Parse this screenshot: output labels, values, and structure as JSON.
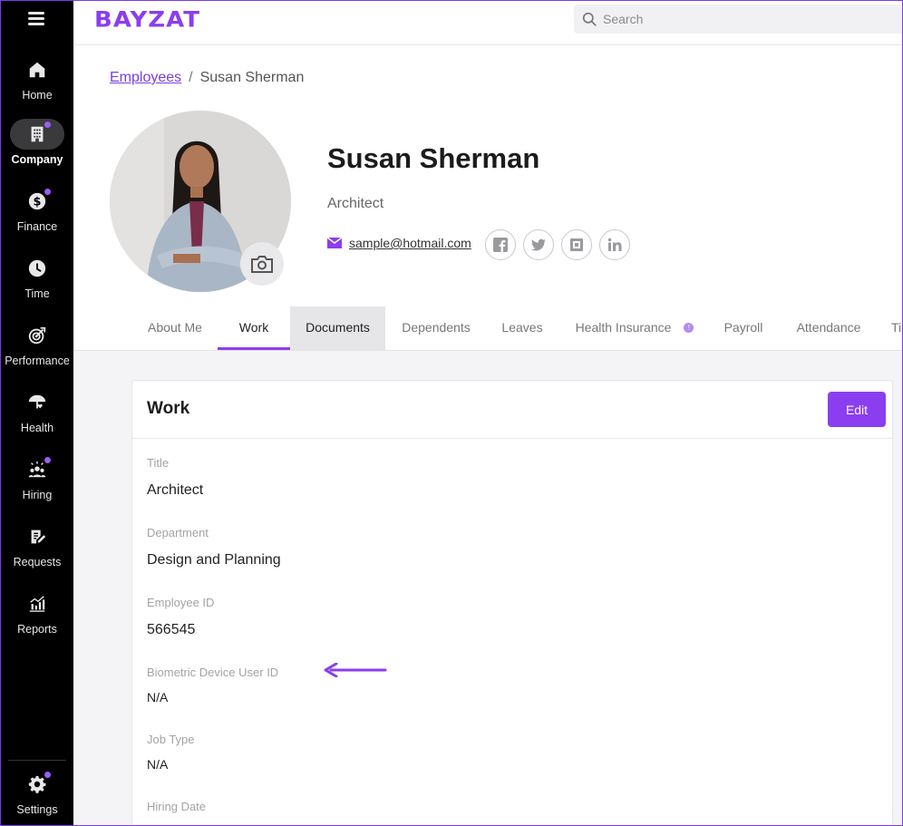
{
  "app": {
    "logo": "BAYZAT"
  },
  "search": {
    "placeholder": "Search"
  },
  "sidebar": {
    "items": [
      {
        "label": "Home",
        "icon": "home-icon",
        "active": false,
        "dot": false
      },
      {
        "label": "Company",
        "icon": "building-icon",
        "active": true,
        "dot": true
      },
      {
        "label": "Finance",
        "icon": "dollar-icon",
        "active": false,
        "dot": true
      },
      {
        "label": "Time",
        "icon": "clock-icon",
        "active": false,
        "dot": false
      },
      {
        "label": "Performance",
        "icon": "target-icon",
        "active": false,
        "dot": false
      },
      {
        "label": "Health",
        "icon": "umbrella-heart-icon",
        "active": false,
        "dot": false
      },
      {
        "label": "Hiring",
        "icon": "people-icon",
        "active": false,
        "dot": true
      },
      {
        "label": "Requests",
        "icon": "clipboard-edit-icon",
        "active": false,
        "dot": false
      },
      {
        "label": "Reports",
        "icon": "chart-icon",
        "active": false,
        "dot": false
      }
    ],
    "settings": {
      "label": "Settings",
      "icon": "gear-icon",
      "dot": true
    }
  },
  "breadcrumb": {
    "parent": "Employees",
    "current": "Susan Sherman"
  },
  "profile": {
    "name": "Susan Sherman",
    "title": "Architect",
    "email": "sample@hotmail.com"
  },
  "tabs": [
    {
      "label": "About Me"
    },
    {
      "label": "Work"
    },
    {
      "label": "Documents"
    },
    {
      "label": "Dependents"
    },
    {
      "label": "Leaves"
    },
    {
      "label": "Health Insurance"
    },
    {
      "label": "Payroll"
    },
    {
      "label": "Attendance"
    },
    {
      "label": "Ti"
    }
  ],
  "work": {
    "heading": "Work",
    "edit_label": "Edit",
    "fields": [
      {
        "label": "Title",
        "value": "Architect"
      },
      {
        "label": "Department",
        "value": "Design and Planning"
      },
      {
        "label": "Employee ID",
        "value": "566545"
      },
      {
        "label": "Biometric Device User ID",
        "value": "N/A"
      },
      {
        "label": "Job Type",
        "value": "N/A"
      },
      {
        "label": "Hiring Date",
        "value": ""
      }
    ]
  },
  "colors": {
    "accent": "#8b3df0",
    "sidebar_bg": "#000000"
  }
}
